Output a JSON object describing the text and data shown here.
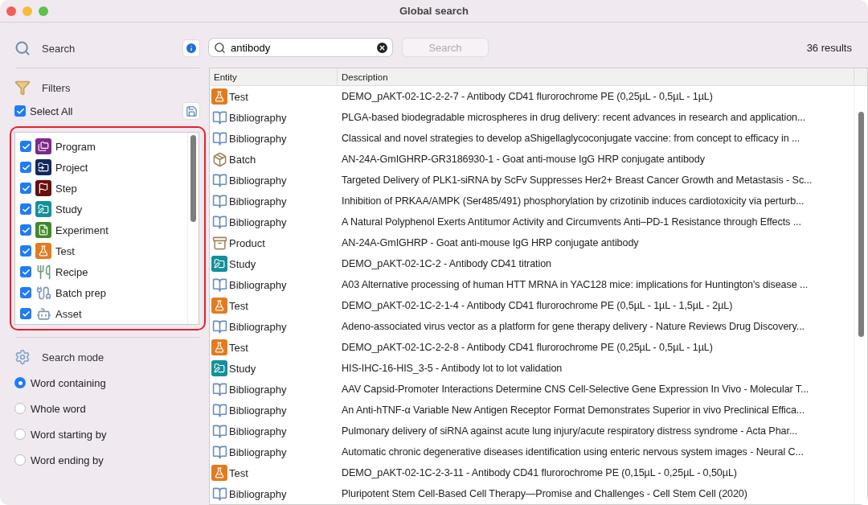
{
  "window": {
    "title": "Global search"
  },
  "sidebar": {
    "search_title": "Search",
    "filters_title": "Filters",
    "select_all": {
      "label": "Select All",
      "checked": true
    },
    "filters": [
      {
        "label": "Program",
        "kind": "program",
        "checked": true
      },
      {
        "label": "Project",
        "kind": "project",
        "checked": true
      },
      {
        "label": "Step",
        "kind": "step",
        "checked": true
      },
      {
        "label": "Study",
        "kind": "study",
        "checked": true
      },
      {
        "label": "Experiment",
        "kind": "experiment",
        "checked": true
      },
      {
        "label": "Test",
        "kind": "test",
        "checked": true
      },
      {
        "label": "Recipe",
        "kind": "recipe",
        "checked": true
      },
      {
        "label": "Batch prep",
        "kind": "batchprep",
        "checked": true
      },
      {
        "label": "Asset",
        "kind": "asset",
        "checked": true
      }
    ],
    "search_mode_title": "Search mode",
    "modes": [
      {
        "label": "Word containing",
        "selected": true
      },
      {
        "label": "Whole word",
        "selected": false
      },
      {
        "label": "Word starting by",
        "selected": false
      },
      {
        "label": "Word ending by",
        "selected": false
      }
    ]
  },
  "search": {
    "value": "antibody",
    "button": "Search",
    "button_disabled": true,
    "results": "36 results"
  },
  "table": {
    "columns": [
      "Entity",
      "Description"
    ],
    "rows": [
      {
        "entity": "Test",
        "kind": "test",
        "description": "DEMO_pAKT-02-1C-2-2-7 - Antibody CD41 flurorochrome PE (0,25µL - 0,5µL - 1µL)"
      },
      {
        "entity": "Bibliography",
        "kind": "bibliography",
        "description": "PLGA-based biodegradable microspheres in drug delivery: recent advances in research and application..."
      },
      {
        "entity": "Bibliography",
        "kind": "bibliography",
        "description": "Classical and novel strategies to develop aShigellaglycoconjugate vaccine: from concept to efficacy in ..."
      },
      {
        "entity": "Batch",
        "kind": "batch",
        "description": "AN-24A-GmIGHRP-GR3186930-1 - Goat anti-mouse IgG HRP conjugate antibody"
      },
      {
        "entity": "Bibliography",
        "kind": "bibliography",
        "description": "Targeted Delivery of PLK1-siRNA by ScFv Suppresses Her2+ Breast Cancer Growth and Metastasis - Sc..."
      },
      {
        "entity": "Bibliography",
        "kind": "bibliography",
        "description": "Inhibition of PRKAA/AMPK (Ser485/491) phosphorylation by crizotinib induces cardiotoxicity via perturb..."
      },
      {
        "entity": "Bibliography",
        "kind": "bibliography",
        "description": "A Natural Polyphenol Exerts Antitumor Activity and Circumvents Anti–PD-1 Resistance through Effects ..."
      },
      {
        "entity": "Product",
        "kind": "product",
        "description": "AN-24A-GmIGHRP - Goat anti-mouse IgG HRP conjugate antibody"
      },
      {
        "entity": "Study",
        "kind": "study",
        "description": "DEMO_pAKT-02-1C-2 - Antibody CD41 titration"
      },
      {
        "entity": "Bibliography",
        "kind": "bibliography",
        "description": "A03 Alternative processing of human HTT MRNA in YAC128 mice: implications for Huntington's disease ..."
      },
      {
        "entity": "Test",
        "kind": "test",
        "description": "DEMO_pAKT-02-1C-2-1-4 - Antibody CD41 flurorochrome PE (0,5µL - 1µL - 1,5µL - 2µL)"
      },
      {
        "entity": "Bibliography",
        "kind": "bibliography",
        "description": "Adeno-associated virus vector as a platform for gene therapy delivery - Nature Reviews Drug Discovery..."
      },
      {
        "entity": "Test",
        "kind": "test",
        "description": "DEMO_pAKT-02-1C-2-2-8 - Antibody CD41 flurorochrome PE (0,25µL - 0,5µL - 1µL)"
      },
      {
        "entity": "Study",
        "kind": "study",
        "description": "HIS-IHC-16-HIS_3-5 - Antibody lot to lot validation"
      },
      {
        "entity": "Bibliography",
        "kind": "bibliography",
        "description": "AAV Capsid-Promoter Interactions Determine CNS Cell-Selective Gene Expression In Vivo - Molecular T..."
      },
      {
        "entity": "Bibliography",
        "kind": "bibliography",
        "description": "An Anti-hTNF-α Variable New Antigen Receptor Format Demonstrates Superior in vivo Preclinical Effica..."
      },
      {
        "entity": "Bibliography",
        "kind": "bibliography",
        "description": "Pulmonary delivery of siRNA against acute lung injury/acute respiratory distress syndrome - Acta Phar..."
      },
      {
        "entity": "Bibliography",
        "kind": "bibliography",
        "description": "Automatic chronic degenerative diseases identification using enteric nervous system images - Neural C..."
      },
      {
        "entity": "Test",
        "kind": "test",
        "description": "DEMO_pAKT-02-1C-2-3-11 - Antibody CD41 flurorochrome PE (0,15µL - 0,25µL - 0,50µL)"
      },
      {
        "entity": "Bibliography",
        "kind": "bibliography",
        "description": "Pluripotent Stem Cell-Based Cell Therapy—Promise and Challenges - Cell Stem Cell (2020)"
      }
    ]
  }
}
